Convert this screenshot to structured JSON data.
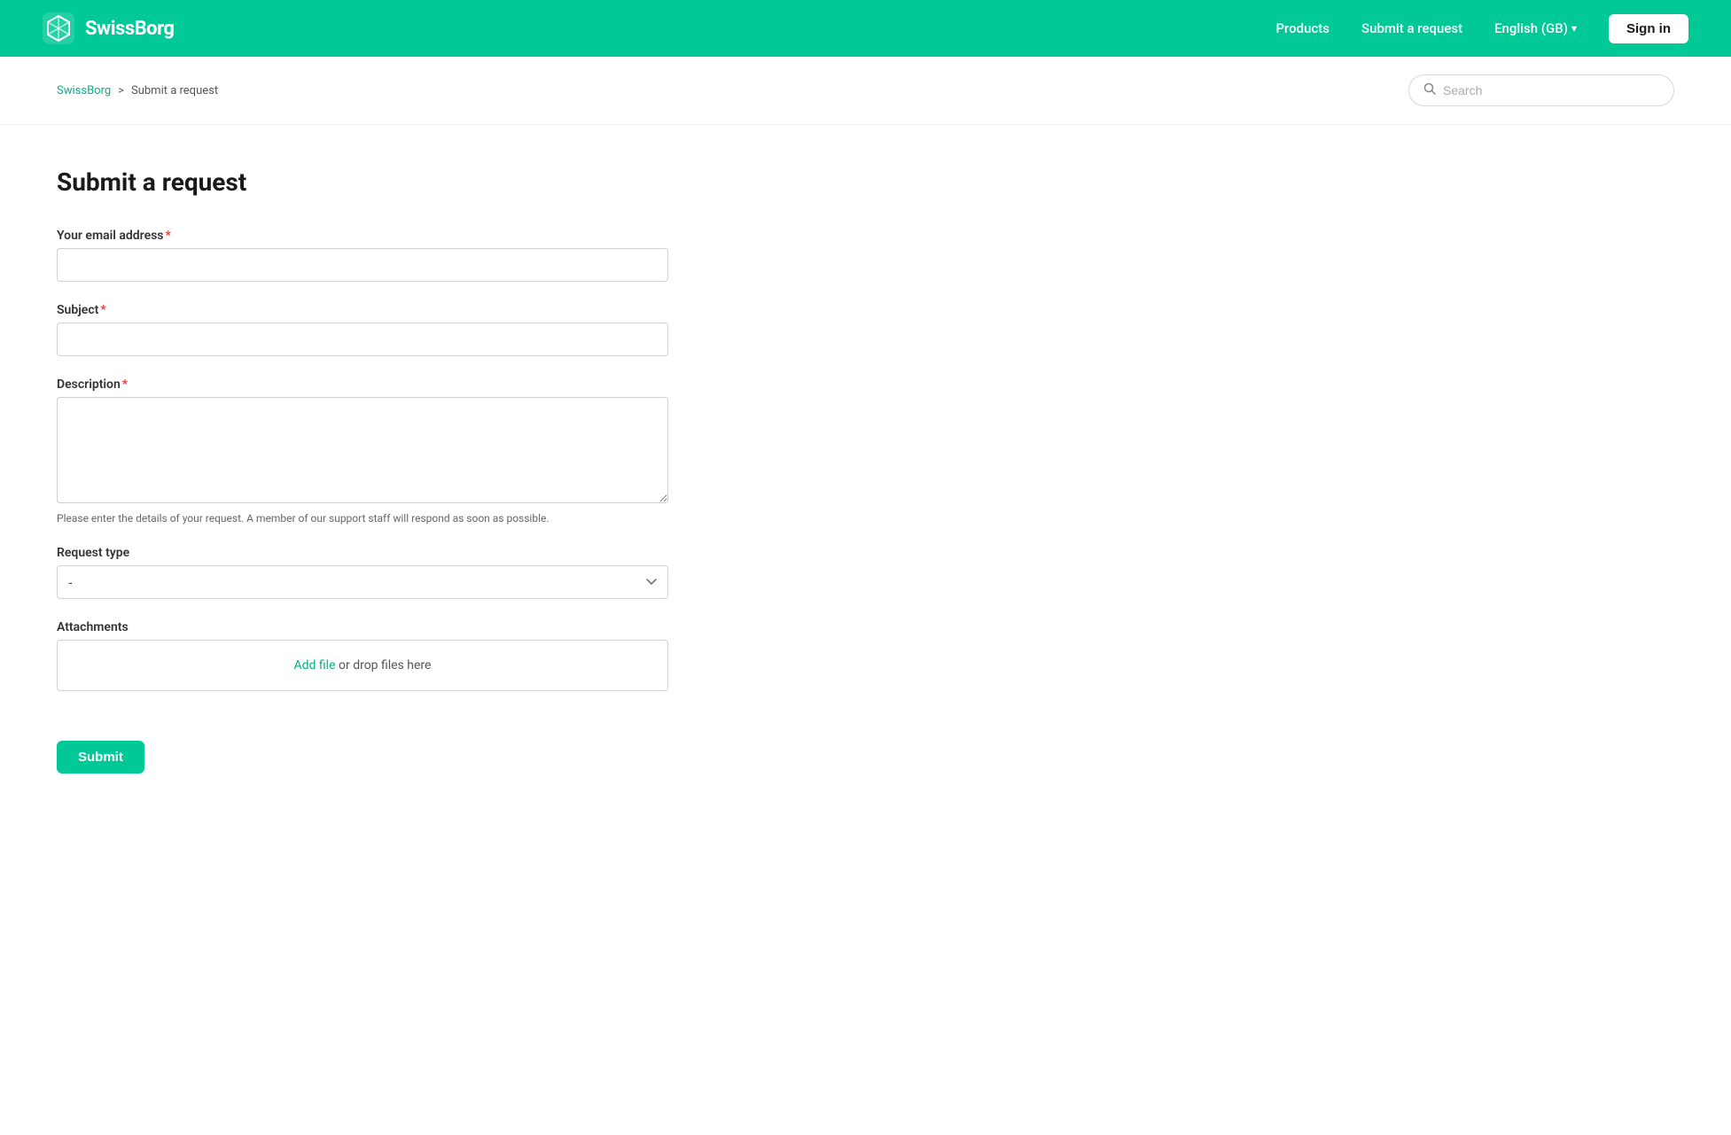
{
  "header": {
    "logo_text": "SwissBorg",
    "nav": {
      "products": "Products",
      "submit_request": "Submit a request",
      "language": "English (GB)",
      "sign_in": "Sign in"
    }
  },
  "breadcrumb": {
    "home_label": "SwissBorg",
    "separator": ">",
    "current": "Submit a request"
  },
  "search": {
    "placeholder": "Search"
  },
  "form": {
    "page_title": "Submit a request",
    "email_label": "Your email address",
    "subject_label": "Subject",
    "description_label": "Description",
    "description_hint": "Please enter the details of your request. A member of our support staff will respond as soon as possible.",
    "request_type_label": "Request type",
    "request_type_default": "-",
    "attachments_label": "Attachments",
    "attach_link_text": "Add file",
    "attach_drop_text": " or drop files here",
    "submit_label": "Submit"
  },
  "colors": {
    "brand_green": "#00c896",
    "link_green": "#00b386",
    "required_red": "#e53e3e"
  }
}
